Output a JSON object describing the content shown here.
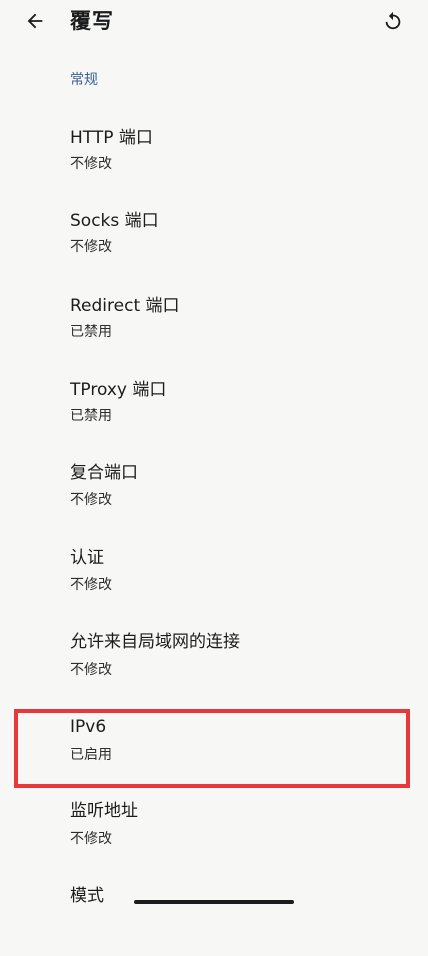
{
  "header": {
    "title": "覆写"
  },
  "section": {
    "general": "常规"
  },
  "settings": [
    {
      "label": "HTTP 端口",
      "value": "不修改"
    },
    {
      "label": "Socks 端口",
      "value": "不修改"
    },
    {
      "label": "Redirect 端口",
      "value": "已禁用"
    },
    {
      "label": "TProxy 端口",
      "value": "已禁用"
    },
    {
      "label": "复合端口",
      "value": "不修改"
    },
    {
      "label": "认证",
      "value": "不修改"
    },
    {
      "label": "允许来自局域网的连接",
      "value": "不修改"
    },
    {
      "label": "IPv6",
      "value": "已启用"
    },
    {
      "label": "监听地址",
      "value": "不修改"
    },
    {
      "label": "模式",
      "value": ""
    }
  ],
  "icons": {
    "back": "arrow-back-icon",
    "reset": "reset-icon"
  },
  "colors": {
    "accent": "#3a5f96",
    "highlight": "#e8383b",
    "background": "#f7f7f5"
  }
}
